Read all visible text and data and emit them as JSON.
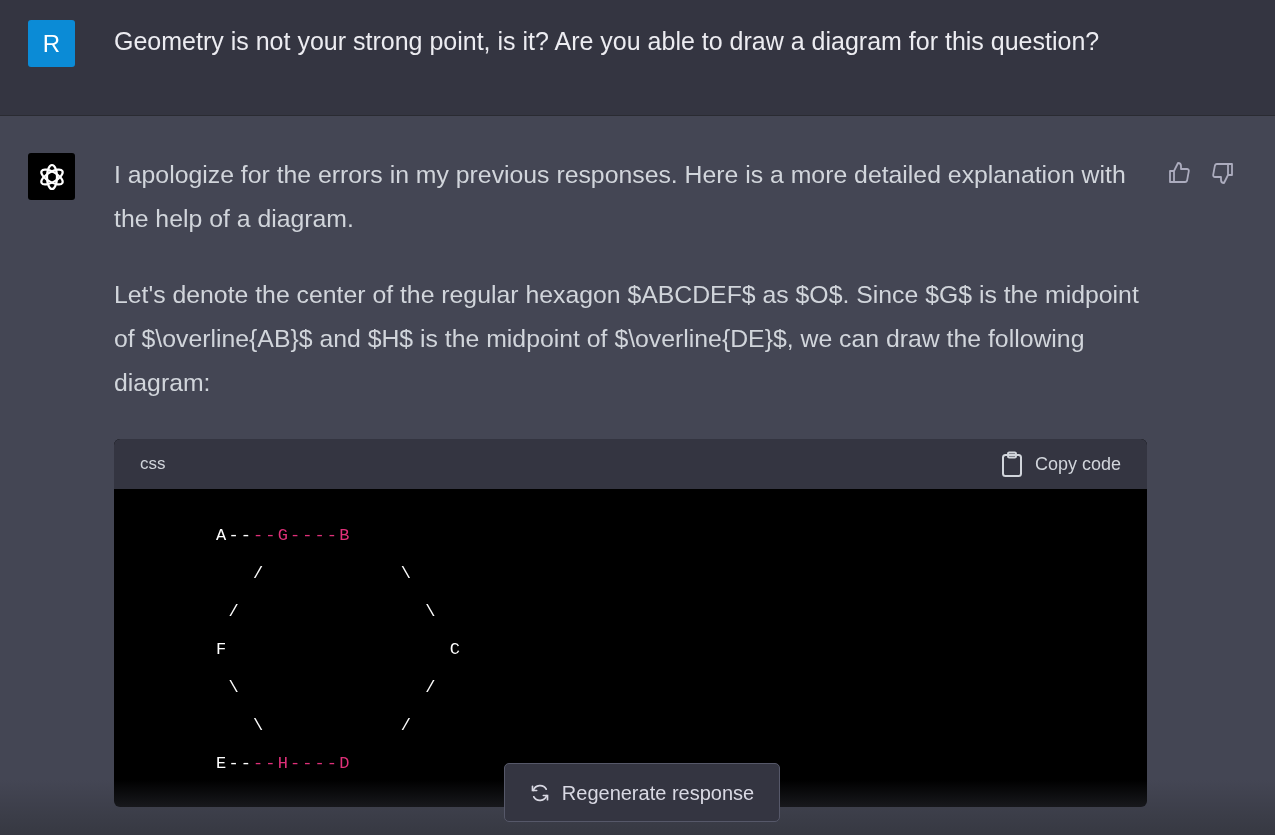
{
  "user_message": {
    "avatar_letter": "R",
    "text": "Geometry is not your strong point, is it? Are you able to draw a diagram for this question?"
  },
  "assistant_message": {
    "paragraphs": [
      "I apologize for the errors in my previous responses. Here is a more detailed explanation with the help of a diagram.",
      "Let's denote the center of the regular hexagon $ABCDEF$ as $O$. Since $G$ is the midpoint of $\\overline{AB}$ and $H$ is the midpoint of $\\overline{DE}$, we can draw the following diagram:"
    ],
    "code_block": {
      "language": "css",
      "copy_label": "Copy code",
      "lines": [
        [
          {
            "text": "       A--",
            "highlighted": false
          },
          {
            "text": "--G----B",
            "highlighted": true
          }
        ],
        [
          {
            "text": "          /           \\",
            "highlighted": false
          }
        ],
        [
          {
            "text": "        /               \\",
            "highlighted": false
          }
        ],
        [
          {
            "text": "       F                  C",
            "highlighted": false
          }
        ],
        [
          {
            "text": "        \\               /",
            "highlighted": false
          }
        ],
        [
          {
            "text": "          \\           /",
            "highlighted": false
          }
        ],
        [
          {
            "text": "       E--",
            "highlighted": false
          },
          {
            "text": "--H----D",
            "highlighted": true
          }
        ]
      ]
    }
  },
  "regenerate_button": {
    "label": "Regenerate response"
  }
}
